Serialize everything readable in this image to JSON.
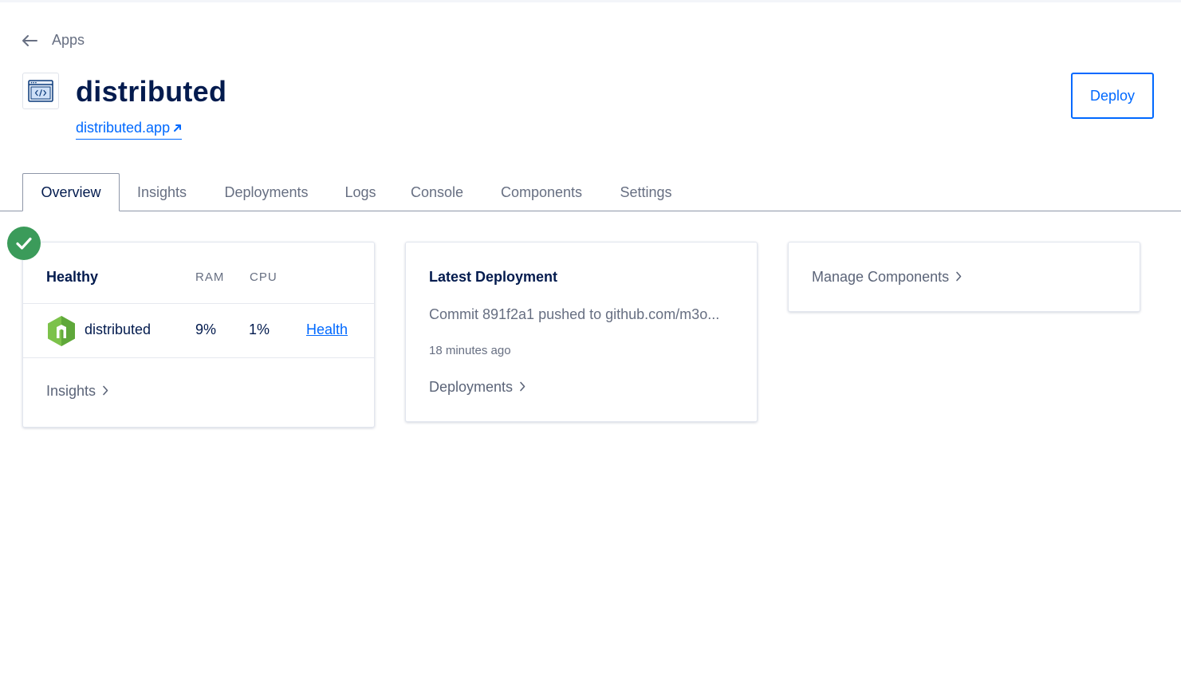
{
  "back": {
    "label": "Apps",
    "icon": "arrow-left-icon"
  },
  "app": {
    "title": "distributed",
    "link_text": "distributed.app",
    "icon": "code-window-icon",
    "link_icon": "external-link-icon"
  },
  "actions": {
    "deploy_label": "Deploy"
  },
  "tabs": [
    {
      "label": "Overview",
      "active": true
    },
    {
      "label": "Insights",
      "active": false
    },
    {
      "label": "Deployments",
      "active": false
    },
    {
      "label": "Logs",
      "active": false
    },
    {
      "label": "Console",
      "active": false
    },
    {
      "label": "Components",
      "active": false
    },
    {
      "label": "Settings",
      "active": false
    }
  ],
  "health_card": {
    "status": "Healthy",
    "status_icon": "check-circle-icon",
    "columns": {
      "ram": "RAM",
      "cpu": "CPU"
    },
    "component": {
      "name": "distributed",
      "icon": "nodejs-hexagon-icon",
      "ram": "9%",
      "cpu": "1%",
      "health_link": "Health"
    },
    "footer_link": "Insights"
  },
  "deployment_card": {
    "title": "Latest Deployment",
    "commit_text": "Commit 891f2a1 pushed to github.com/m3o...",
    "time_ago": "18 minutes ago",
    "footer_link": "Deployments"
  },
  "components_card": {
    "link": "Manage Components"
  },
  "colors": {
    "accent": "#0069ff",
    "heading": "#031b4e",
    "muted": "#676f82",
    "success": "#3b9b5a",
    "nodejs": "#7cc24a"
  }
}
